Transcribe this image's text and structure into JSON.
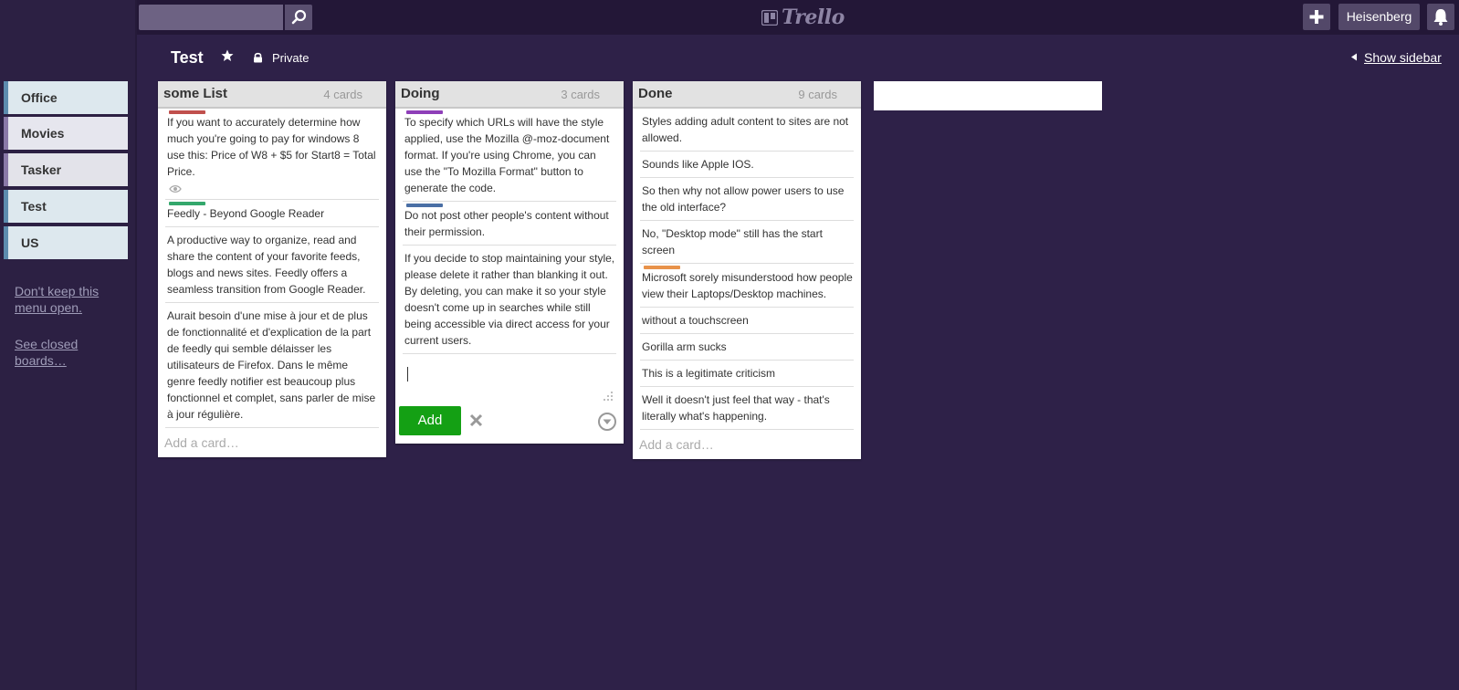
{
  "header": {
    "search_value": "",
    "logo_text": "Trello",
    "user_name": "Heisenberg"
  },
  "leftmenu": {
    "boards": [
      {
        "label": "Office"
      },
      {
        "label": "Movies"
      },
      {
        "label": "Tasker"
      },
      {
        "label": "Test"
      },
      {
        "label": "US"
      }
    ],
    "dont_keep_open": "Don't keep this menu open.",
    "see_closed": "See closed boards…"
  },
  "board": {
    "title": "Test",
    "privacy": "Private",
    "show_sidebar": "Show sidebar"
  },
  "lists": [
    {
      "title": "some List",
      "count": "4 cards",
      "add_card": "Add a card…",
      "cards": [
        {
          "label_color": "#c0504d",
          "text": "If you want to accurately determine how much you're going to pay for windows 8 use this: Price of W8 + $5 for Start8 = Total Price.",
          "badge": "eye-icon"
        },
        {
          "label_color": "#34a86c",
          "text": "Feedly - Beyond Google Reader"
        },
        {
          "text": "A productive way to organize, read and share the content of your favorite feeds, blogs and news sites. Feedly offers a seamless transition from Google Reader."
        },
        {
          "text": "Aurait besoin d'une mise à jour et de plus de fonctionnalité et d'explication de la part de feedly qui semble délaisser les utilisateurs de Firefox. Dans le même genre feedly notifier est beaucoup plus fonctionnel et complet, sans parler de mise à jour régulière."
        }
      ]
    },
    {
      "title": "Doing",
      "count": "3 cards",
      "cards": [
        {
          "label_color": "#8e3fb8",
          "text": "To specify which URLs will have the style applied, use the Mozilla @-moz-document format. If you're using Chrome, you can use the \"To Mozilla Format\" button to generate the code."
        },
        {
          "label_color": "#4a6fa5",
          "text": "Do not post other people's content without their permission."
        },
        {
          "text": "If you decide to stop maintaining your style, please delete it rather than blanking it out. By deleting, you can make it so your style doesn't come up in searches while still being accessible via direct access for your current users."
        }
      ],
      "composer": {
        "value": "",
        "add_button": "Add"
      }
    },
    {
      "title": "Done",
      "count": "9 cards",
      "add_card": "Add a card…",
      "cards": [
        {
          "text": "Styles adding adult content to sites are not allowed."
        },
        {
          "text": "Sounds like Apple IOS."
        },
        {
          "text": "So then why not allow power users to use the old interface?"
        },
        {
          "text": "No, \"Desktop mode\" still has the start screen"
        },
        {
          "label_color": "#e8924a",
          "text": "Microsoft sorely misunderstood how people view their Laptops/Desktop machines."
        },
        {
          "text": "without a touchscreen"
        },
        {
          "text": "Gorilla arm sucks"
        },
        {
          "text": "This is a legitimate criticism"
        },
        {
          "text": "Well it doesn't just feel that way - that's literally what's happening."
        }
      ]
    }
  ],
  "add_list": {
    "value": "",
    "placeholder": ""
  },
  "colors": {
    "background": "#2e2148",
    "header": "#231737",
    "add_button": "#14a014"
  }
}
